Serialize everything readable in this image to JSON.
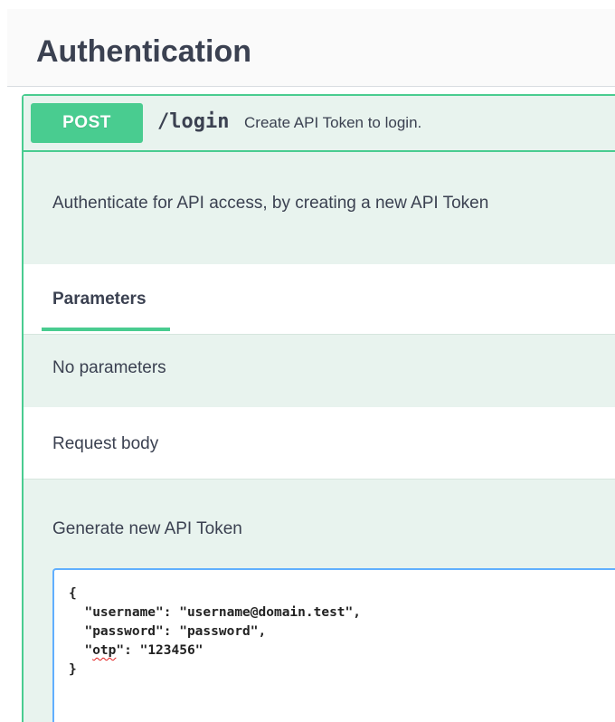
{
  "section": {
    "title": "Authentication"
  },
  "operation": {
    "method": "POST",
    "path": "/login",
    "summary": "Create API Token to login.",
    "description": "Authenticate for API access, by creating a new API Token"
  },
  "parameters": {
    "tab_label": "Parameters",
    "empty_text": "No parameters"
  },
  "request_body": {
    "label": "Request body",
    "description": "Generate new API Token",
    "lines": {
      "open": "{",
      "username_line": "  \"username\": \"username@domain.test\",",
      "password_line": "  \"password\": \"password\",",
      "otp_indent": "  \"",
      "otp_key": "otp",
      "otp_rest": "\": \"123456\"",
      "close": "}"
    }
  },
  "colors": {
    "post_green": "#49cc90",
    "post_bg": "#e8f3ee",
    "editor_border": "#61affe",
    "text": "#3b4151"
  }
}
